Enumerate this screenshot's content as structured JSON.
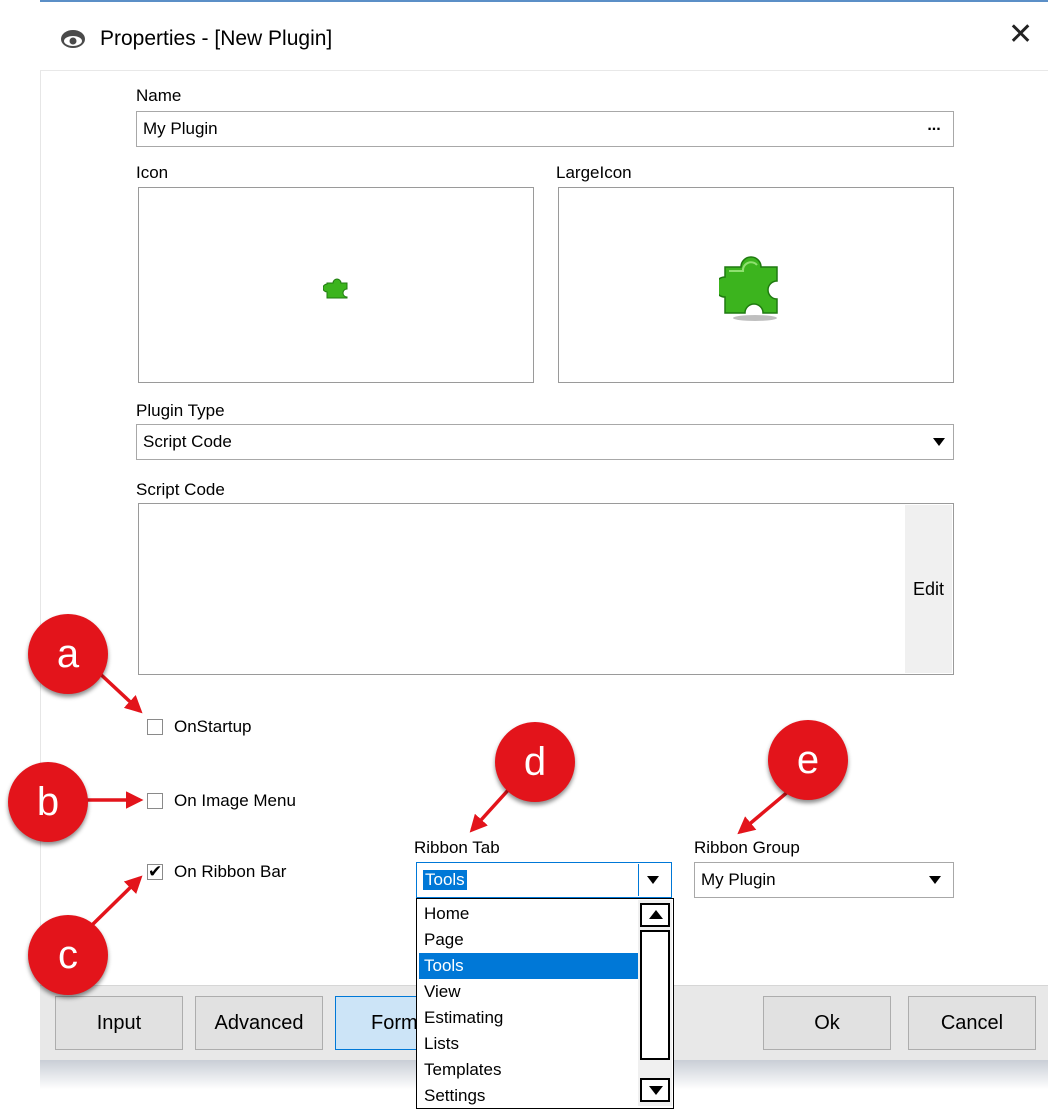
{
  "window": {
    "title": "Properties - [New Plugin]",
    "app_icon": "eye-icon",
    "close_label": "✕"
  },
  "form": {
    "name_label": "Name",
    "name_value": "My Plugin",
    "name_button": "...",
    "icon_label": "Icon",
    "large_icon_label": "LargeIcon",
    "icon_image": "puzzle-piece-icon",
    "plugin_type_label": "Plugin Type",
    "plugin_type_value": "Script Code",
    "script_code_label": "Script Code",
    "edit_button": "Edit",
    "on_startup_label": "OnStartup",
    "on_startup_checked": false,
    "on_image_menu_label": "On Image Menu",
    "on_image_menu_checked": false,
    "on_ribbon_bar_label": "On Ribbon Bar",
    "on_ribbon_bar_checked": true,
    "ribbon_tab_label": "Ribbon Tab",
    "ribbon_tab_value": "Tools",
    "ribbon_tab_options": [
      "Home",
      "Page",
      "Tools",
      "View",
      "Estimating",
      "Lists",
      "Templates",
      "Settings"
    ],
    "ribbon_tab_selected_index": 2,
    "ribbon_group_label": "Ribbon Group",
    "ribbon_group_value": "My Plugin"
  },
  "callouts": [
    "a",
    "b",
    "c",
    "d",
    "e"
  ],
  "bottom_buttons": {
    "input": "Input",
    "advanced": "Advanced",
    "form_partial": "Form",
    "ok": "Ok",
    "cancel": "Cancel"
  },
  "colors": {
    "callout_red": "#e3141b",
    "arrow_red": "#e3141b",
    "selection_blue": "#0078d7",
    "puzzle_green": "#3cb41e",
    "active_button": "#cce4f7"
  }
}
